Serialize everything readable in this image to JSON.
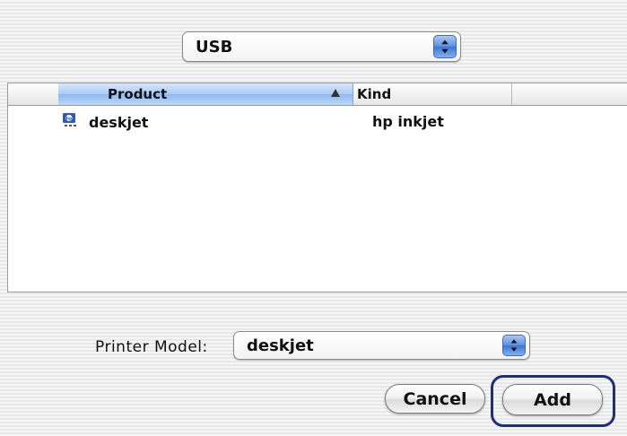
{
  "connection_popup": {
    "value": "USB"
  },
  "table": {
    "columns": [
      "Product",
      "Kind"
    ],
    "rows": [
      {
        "icon": "hp-printer-icon",
        "product": "deskjet",
        "kind": "hp inkjet"
      }
    ]
  },
  "printer_model": {
    "label": "Printer Model:",
    "value": "deskjet"
  },
  "buttons": {
    "cancel": "Cancel",
    "add": "Add"
  },
  "colors": {
    "header_selected": "#a9cbf5",
    "highlight_ring": "#1d2f7a",
    "stepper_blue": "#3c76d6"
  }
}
